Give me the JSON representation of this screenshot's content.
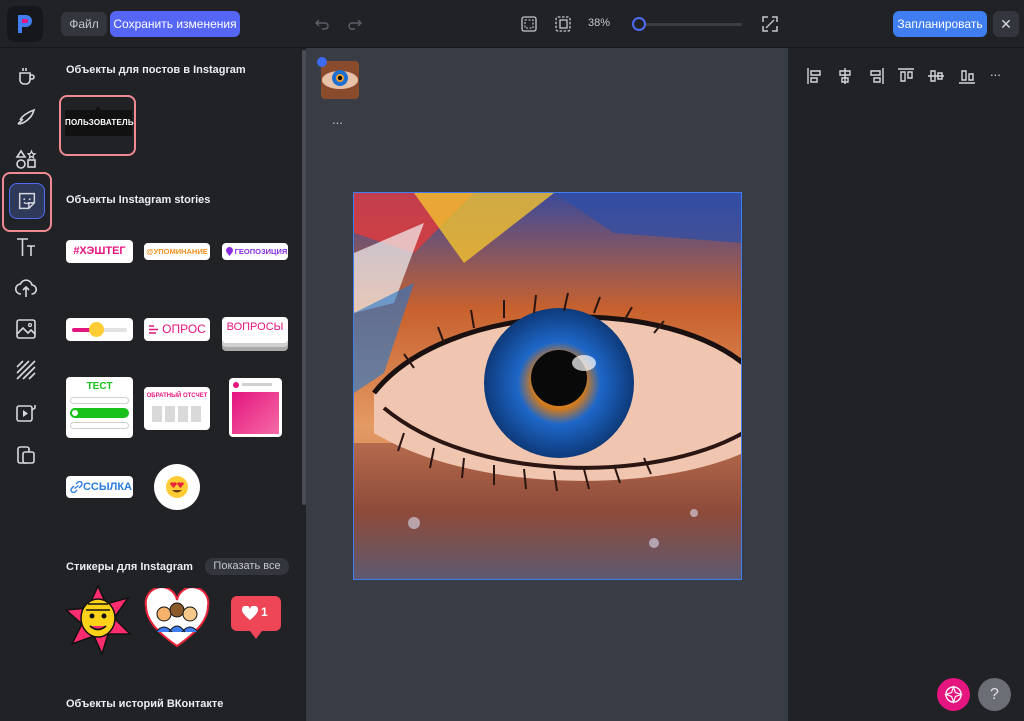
{
  "topbar": {
    "file_label": "Файл",
    "save_label": "Сохранить изменения",
    "zoom_label": "38%",
    "zoom_value_percent": 38,
    "schedule_label": "Запланировать",
    "close_label": "✕"
  },
  "panel": {
    "section_posts": "Объекты для постов в Instagram",
    "user_tag": "ПОЛЬЗОВАТЕЛЬ",
    "section_stories": "Объекты Instagram stories",
    "hashtag": "#ХЭШТЕГ",
    "mention": "@УПОМИНАНИЕ",
    "location": "ГЕОПОЗИЦИЯ",
    "poll": "ОПРОС",
    "questions": "ВОПРОСЫ",
    "quiz": "ТЕСТ",
    "countdown": "ОБРАТНЫЙ ОТСЧЕТ",
    "link": "ССЫЛКА",
    "section_stickers": "Стикеры для Instagram",
    "show_all": "Показать все",
    "like_count": "1",
    "section_vk": "Объекты историй ВКонтакте"
  },
  "canvas": {
    "thumb_more": "..."
  },
  "right": {
    "more": "..."
  },
  "help_label": "?",
  "colors": {
    "accent": "#5565f5",
    "schedule": "#3f7df0",
    "highlight": "#f08a92",
    "ai": "#e4157f"
  }
}
